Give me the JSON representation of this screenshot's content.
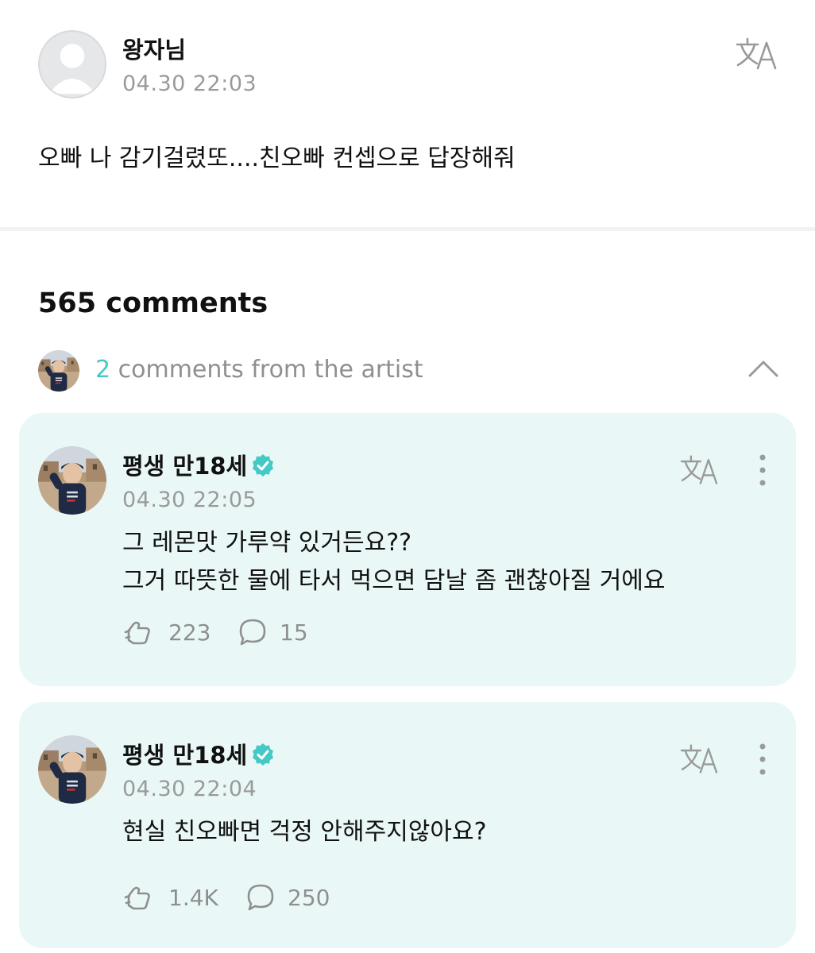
{
  "post": {
    "author": "왕자님",
    "timestamp": "04.30 22:03",
    "body": "오빠 나 감기걸렸또....친오빠 컨셉으로 답장해줘",
    "translate_icon": "translate-icon"
  },
  "comments": {
    "count_label": "565 comments",
    "artist_summary": {
      "count": "2",
      "label": "comments from the artist",
      "toggle_icon": "chevron-up-icon"
    },
    "items": [
      {
        "author": "평생 만18세",
        "verified": true,
        "timestamp": "04.30 22:05",
        "lines": [
          "그 레몬맛 가루약 있거든요??",
          "그거 따뜻한 물에 타서 먹으면 담날 좀 괜찮아질 거에요"
        ],
        "likes": "223",
        "replies": "15"
      },
      {
        "author": "평생 만18세",
        "verified": true,
        "timestamp": "04.30 22:04",
        "lines": [
          "현실 친오빠면 걱정 안해주지않아요?"
        ],
        "likes": "1.4K",
        "replies": "250"
      }
    ]
  },
  "colors": {
    "accent": "#45c9c6",
    "card_background": "#e9f8f6",
    "muted_text": "#9a9a9a"
  }
}
